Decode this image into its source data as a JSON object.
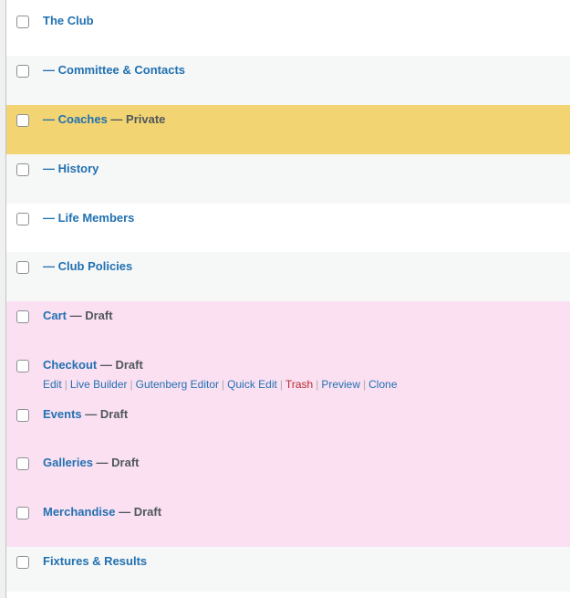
{
  "rows": [
    {
      "title": "The Club",
      "state": ""
    },
    {
      "title": "— Committee & Contacts",
      "state": ""
    },
    {
      "title": "— Coaches",
      "state": " — Private"
    },
    {
      "title": "— History",
      "state": ""
    },
    {
      "title": "— Life Members",
      "state": ""
    },
    {
      "title": "— Club Policies",
      "state": ""
    },
    {
      "title": "Cart",
      "state": " — Draft"
    },
    {
      "title": "Checkout",
      "state": " — Draft"
    },
    {
      "title": "Events",
      "state": " — Draft"
    },
    {
      "title": "Galleries",
      "state": " — Draft"
    },
    {
      "title": "Merchandise",
      "state": " — Draft"
    },
    {
      "title": "Fixtures & Results",
      "state": ""
    }
  ],
  "row_actions": {
    "edit": "Edit",
    "live_builder": "Live Builder",
    "gutenberg_editor": "Gutenberg Editor",
    "quick_edit": "Quick Edit",
    "trash": "Trash",
    "preview": "Preview",
    "clone": "Clone",
    "separator": "|"
  },
  "colors": {
    "link": "#2271b1",
    "trash": "#b32d2e",
    "private_highlight": "#f2d472",
    "draft_highlight": "#fbe0f2",
    "alt_row": "#f6f7f7"
  }
}
